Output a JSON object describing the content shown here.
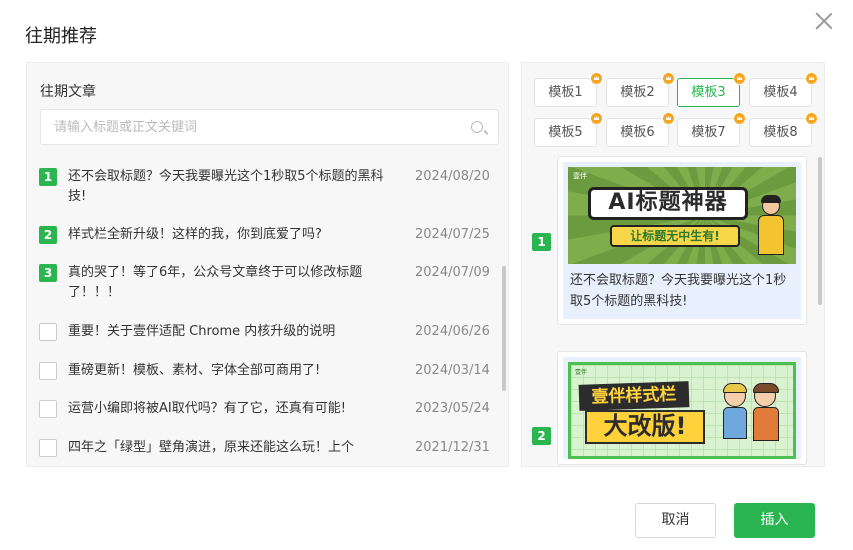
{
  "dialog": {
    "title": "往期推荐",
    "close_icon": "close-icon"
  },
  "left": {
    "heading": "往期文章",
    "search_placeholder": "请输入标题或正文关键词",
    "articles": [
      {
        "checked": true,
        "num": "1",
        "title": "还不会取标题？今天我要曝光这个1秒取5个标题的黑科技!",
        "date": "2024/08/20"
      },
      {
        "checked": true,
        "num": "2",
        "title": "样式栏全新升级！这样的我，你到底爱了吗?",
        "date": "2024/07/25"
      },
      {
        "checked": true,
        "num": "3",
        "title": "真的哭了！等了6年，公众号文章终于可以修改标题了！！！",
        "date": "2024/07/09"
      },
      {
        "checked": false,
        "num": "",
        "title": "重要！关于壹伴适配 Chrome 内核升级的说明",
        "date": "2024/06/26"
      },
      {
        "checked": false,
        "num": "",
        "title": "重磅更新！模板、素材、字体全部可商用了!",
        "date": "2024/03/14"
      },
      {
        "checked": false,
        "num": "",
        "title": "运营小编即将被AI取代吗？有了它，还真有可能!",
        "date": "2023/05/24"
      },
      {
        "checked": false,
        "num": "",
        "title": "四年之「绿型」壁角演进，原来还能这么玩！上个",
        "date": "2021/12/31"
      }
    ]
  },
  "templates": [
    {
      "label": "模板1",
      "active": false
    },
    {
      "label": "模板2",
      "active": false
    },
    {
      "label": "模板3",
      "active": true
    },
    {
      "label": "模板4",
      "active": false
    },
    {
      "label": "模板5",
      "active": false
    },
    {
      "label": "模板6",
      "active": false
    },
    {
      "label": "模板7",
      "active": false
    },
    {
      "label": "模板8",
      "active": false
    }
  ],
  "preview": {
    "cards": [
      {
        "num": "1",
        "text": "还不会取标题？今天我要曝光这个1秒取5个标题的黑科技!",
        "thumb_title": "AI标题神器",
        "thumb_sub": "让标题无中生有!",
        "thumb_logo": "壹伴"
      },
      {
        "num": "2",
        "text": "",
        "thumb_title": "壹伴样式栏",
        "thumb_sub": "大改版!",
        "thumb_logo": "壹伴"
      }
    ]
  },
  "footer": {
    "cancel_label": "取消",
    "insert_label": "插入"
  },
  "colors": {
    "accent": "#2ab550",
    "crown": "#f5a623",
    "card_bg": "#e8f0fe"
  }
}
